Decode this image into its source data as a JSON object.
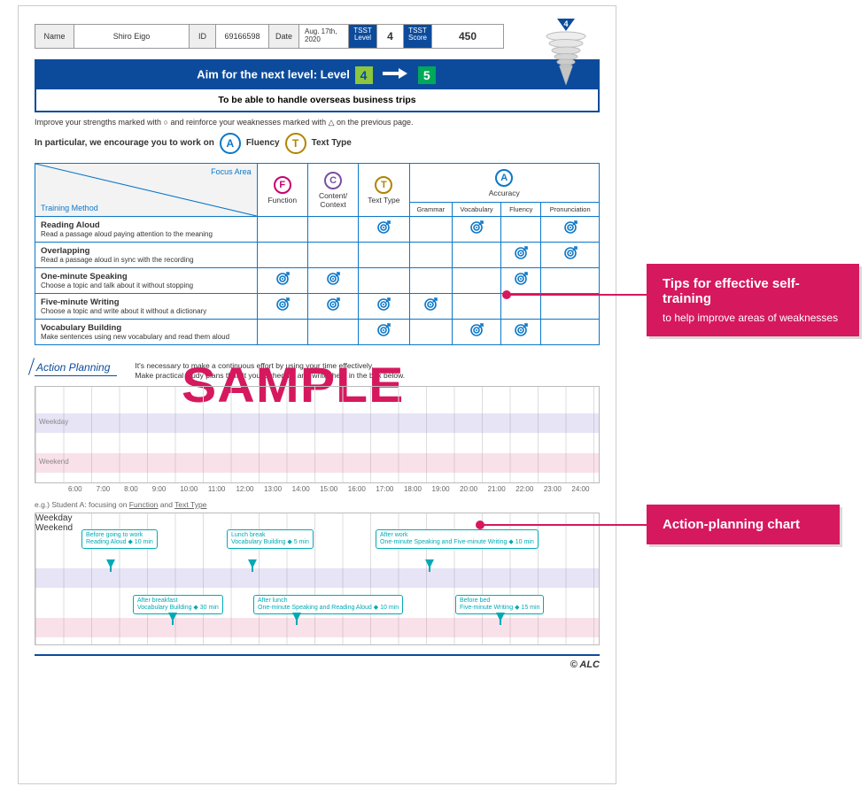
{
  "header": {
    "name_label": "Name",
    "name_value": "Shiro Eigo",
    "id_label": "ID",
    "id_value": "69166598",
    "date_label": "Date",
    "date_value": "Aug. 17th, 2020",
    "tsst_level_label": "TSST Level",
    "tsst_level_value": "4",
    "tsst_score_label": "TSST Score",
    "tsst_score_value": "450",
    "cone_level": "4"
  },
  "aim": {
    "prefix": "Aim for the next level: Level",
    "current": "4",
    "next": "5",
    "subtitle": "To be able to handle overseas business trips"
  },
  "instructions": {
    "improve": "Improve your strengths marked with ○ and reinforce your weaknesses marked with △ on the previous page.",
    "encourage": "In particular, we encourage you to work on",
    "focus1_badge": "A",
    "focus1_label": "Fluency",
    "focus2_badge": "T",
    "focus2_label": "Text Type"
  },
  "table": {
    "focus_area": "Focus Area",
    "training_method": "Training Method",
    "cols": {
      "function": {
        "badge": "F",
        "label": "Function"
      },
      "content": {
        "badge": "C",
        "label": "Content/ Context"
      },
      "texttype": {
        "badge": "T",
        "label": "Text Type"
      },
      "accuracy": {
        "badge": "A",
        "label": "Accuracy"
      },
      "acc_sub": [
        "Grammar",
        "Vocabulary",
        "Fluency",
        "Pronunciation"
      ]
    },
    "rows": [
      {
        "title": "Reading Aloud",
        "desc": "Read a passage aloud paying attention to the meaning",
        "marks": {
          "function": false,
          "content": false,
          "texttype": true,
          "grammar": false,
          "vocab": true,
          "fluency": false,
          "pron": true
        }
      },
      {
        "title": "Overlapping",
        "desc": "Read a passage aloud in sync with the recording",
        "marks": {
          "function": false,
          "content": false,
          "texttype": false,
          "grammar": false,
          "vocab": false,
          "fluency": true,
          "pron": true
        }
      },
      {
        "title": "One-minute Speaking",
        "desc": "Choose a topic and talk about it without stopping",
        "marks": {
          "function": true,
          "content": true,
          "texttype": false,
          "grammar": false,
          "vocab": false,
          "fluency": true,
          "pron": false
        }
      },
      {
        "title": "Five-minute Writing",
        "desc": "Choose a topic and write about it without a dictionary",
        "marks": {
          "function": true,
          "content": true,
          "texttype": true,
          "grammar": true,
          "vocab": false,
          "fluency": false,
          "pron": false
        }
      },
      {
        "title": "Vocabulary Building",
        "desc": "Make sentences using new vocabulary and read them aloud",
        "marks": {
          "function": false,
          "content": false,
          "texttype": true,
          "grammar": false,
          "vocab": true,
          "fluency": true,
          "pron": false
        }
      }
    ]
  },
  "watermark": "SAMPLE",
  "action_planning": {
    "title": "Action Planning",
    "instr1": "It's necessary to make a continuous effort by using your time effectively.",
    "instr2": "Make practical study plans that fit your schedule and write them in the box below.",
    "weekday": "Weekday",
    "weekend": "Weekend",
    "times": [
      "6:00",
      "7:00",
      "8:00",
      "9:00",
      "10:00",
      "11:00",
      "12:00",
      "13:00",
      "14:00",
      "15:00",
      "16:00",
      "17:00",
      "18:00",
      "19:00",
      "20:00",
      "21:00",
      "22:00",
      "23:00",
      "24:00"
    ]
  },
  "example": {
    "caption_prefix": "e.g.) Student A: focusing on ",
    "caption_u1": "Function",
    "caption_mid": " and ",
    "caption_u2": "Text Type",
    "bubbles": [
      {
        "head": "Before going to work",
        "body": "Reading Aloud ◆ 10 min"
      },
      {
        "head": "Lunch break",
        "body": "Vocabulary Building ◆ 5 min"
      },
      {
        "head": "After work",
        "body": "One-minute Speaking and Five-minute Writing ◆ 10 min"
      },
      {
        "head": "After breakfast",
        "body": "Vocabulary Building ◆ 30 min"
      },
      {
        "head": "After lunch",
        "body": "One-minute Speaking and Reading Aloud ◆ 10 min"
      },
      {
        "head": "Before bed",
        "body": "Five-minute Writing ◆ 15 min"
      }
    ]
  },
  "footer": {
    "brand": "© ALC"
  },
  "callouts": {
    "tips_title": "Tips for effective self-training",
    "tips_sub": "to help improve areas of weaknesses",
    "chart_title": "Action-planning chart"
  }
}
